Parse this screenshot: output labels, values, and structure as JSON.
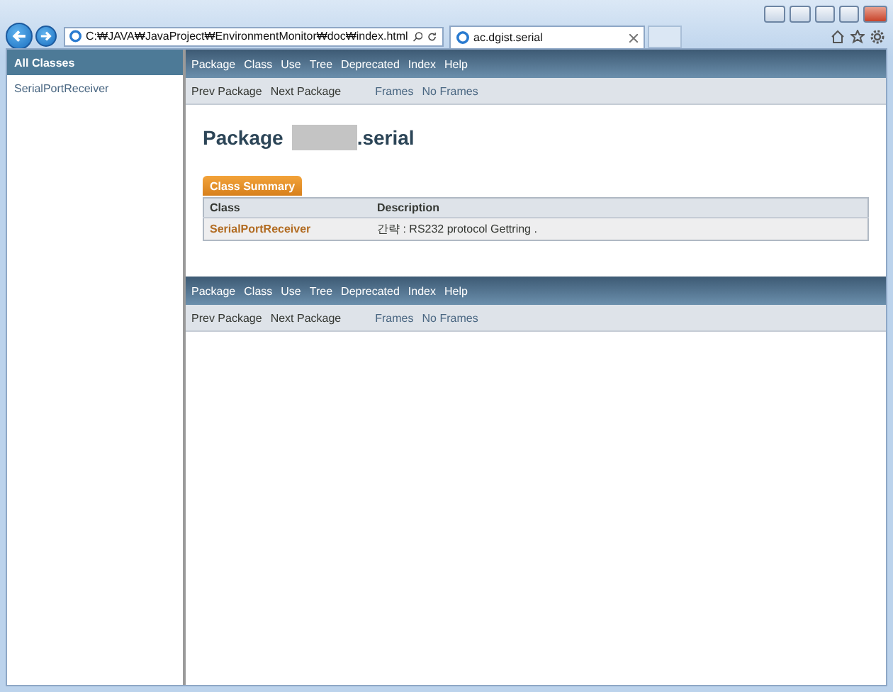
{
  "browser": {
    "address": "C:₩JAVA₩JavaProject₩EnvironmentMonitor₩doc₩index.html",
    "tab_title": "ac.dgist.serial"
  },
  "left_frame": {
    "heading": "All Classes",
    "items": [
      "SerialPortReceiver"
    ]
  },
  "top_nav": {
    "items": [
      "Package",
      "Class",
      "Use",
      "Tree",
      "Deprecated",
      "Index",
      "Help"
    ],
    "sub_left": [
      "Prev Package",
      "Next Package"
    ],
    "sub_right": [
      "Frames",
      "No Frames"
    ]
  },
  "package_title": {
    "prefix": "Package",
    "suffix": ".serial"
  },
  "class_summary": {
    "caption": "Class Summary",
    "columns": [
      "Class",
      "Description"
    ],
    "rows": [
      {
        "class": "SerialPortReceiver",
        "description": "간략 : RS232 protocol Gettring ."
      }
    ]
  },
  "bottom_nav": {
    "items": [
      "Package",
      "Class",
      "Use",
      "Tree",
      "Deprecated",
      "Index",
      "Help"
    ],
    "sub_left": [
      "Prev Package",
      "Next Package"
    ],
    "sub_right": [
      "Frames",
      "No Frames"
    ]
  }
}
